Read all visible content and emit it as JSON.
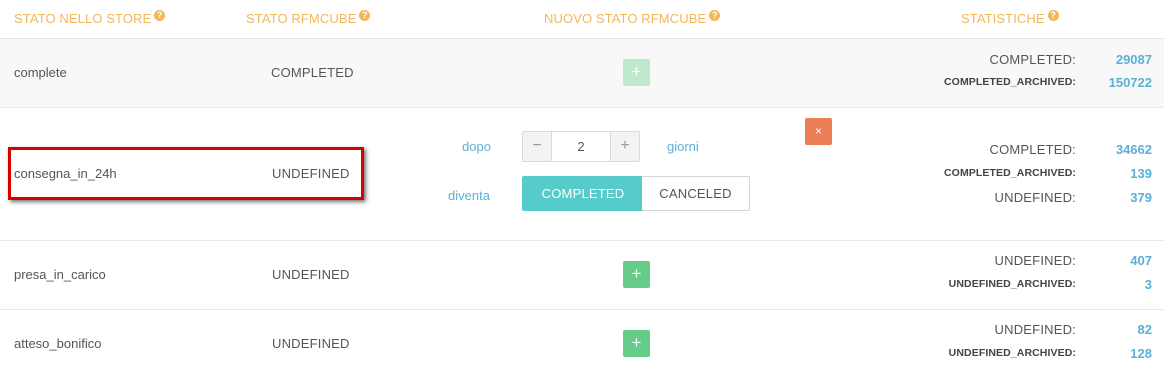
{
  "headers": {
    "store": "STATO NELLO STORE",
    "rfm": "STATO RFMCUBE",
    "new": "NUOVO STATO RFMCUBE",
    "stats": "STATISTICHE",
    "help_glyph": "?"
  },
  "icons": {
    "plus": "+",
    "minus": "−",
    "close": "×"
  },
  "rows": [
    {
      "store": "complete",
      "rfm": "COMPLETED",
      "stats": [
        {
          "label": "COMPLETED:",
          "value": "29087"
        },
        {
          "label": "COMPLETED_ARCHIVED:",
          "value": "150722"
        }
      ]
    },
    {
      "store": "consegna_in_24h",
      "rfm": "UNDEFINED",
      "rule": {
        "after_label": "dopo",
        "days": "2",
        "days_label": "giorni",
        "becomes_label": "diventa",
        "options": [
          "COMPLETED",
          "CANCELED"
        ],
        "selected": "COMPLETED"
      },
      "stats": [
        {
          "label": "COMPLETED:",
          "value": "34662"
        },
        {
          "label": "COMPLETED_ARCHIVED:",
          "value": "139"
        },
        {
          "label": "UNDEFINED:",
          "value": "379"
        }
      ]
    },
    {
      "store": "presa_in_carico",
      "rfm": "UNDEFINED",
      "stats": [
        {
          "label": "UNDEFINED:",
          "value": "407"
        },
        {
          "label": "UNDEFINED_ARCHIVED:",
          "value": "3"
        }
      ]
    },
    {
      "store": "atteso_bonifico",
      "rfm": "UNDEFINED",
      "stats": [
        {
          "label": "UNDEFINED:",
          "value": "82"
        },
        {
          "label": "UNDEFINED_ARCHIVED:",
          "value": "128"
        }
      ]
    }
  ],
  "colors": {
    "header": "#f2b759",
    "add": "#66cc8a",
    "add_disabled": "#bfe9cc",
    "remove": "#ec7e57",
    "accent": "#55cbcb",
    "link": "#5bb0d5",
    "highlight": "#d70000"
  }
}
